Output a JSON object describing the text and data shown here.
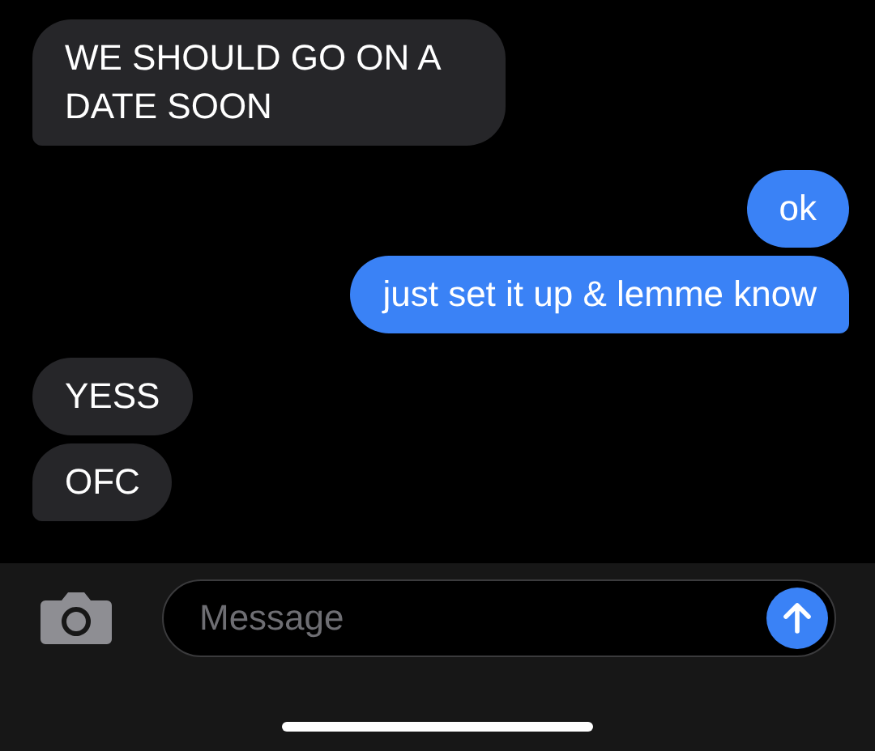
{
  "messages": [
    {
      "kind": "incoming",
      "text": "WE SHOULD GO ON A DATE SOON",
      "tail": true
    },
    {
      "kind": "outgoing",
      "text": "ok",
      "tail": false
    },
    {
      "kind": "outgoing",
      "text": "just set it up & lemme know",
      "tail": true
    },
    {
      "kind": "incoming",
      "text": "YESS",
      "tail": false
    },
    {
      "kind": "incoming",
      "text": "OFC",
      "tail": true
    }
  ],
  "composer": {
    "placeholder": "Message"
  }
}
